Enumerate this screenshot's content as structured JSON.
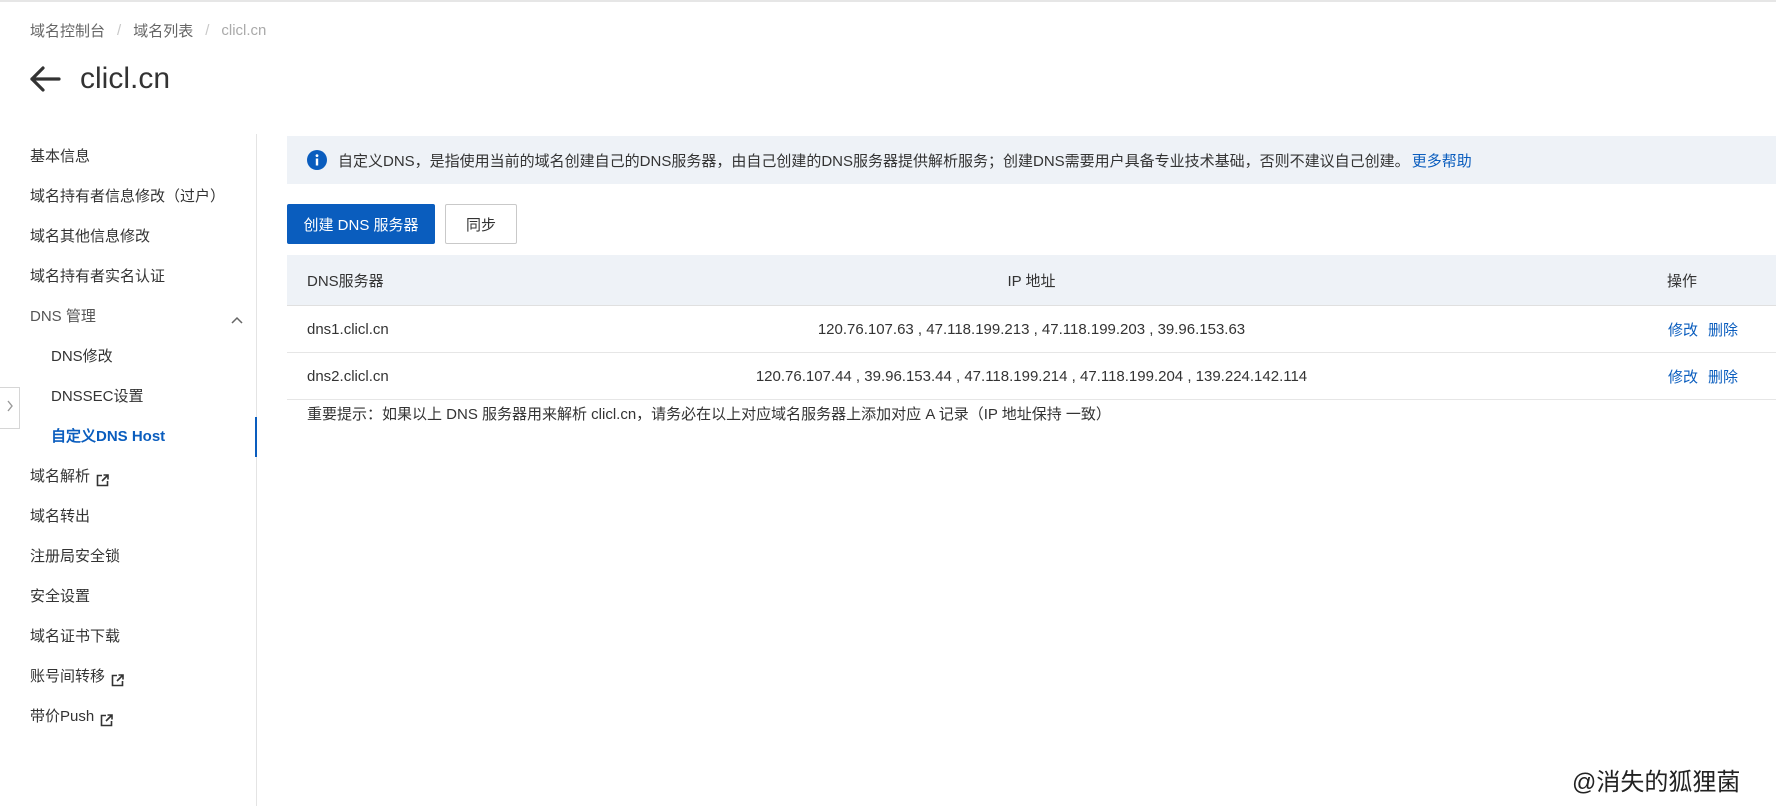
{
  "breadcrumb": [
    "域名控制台",
    "域名列表",
    "clicl.cn"
  ],
  "page": {
    "title": "clicl.cn"
  },
  "sidebar": {
    "items": [
      {
        "label": "基本信息"
      },
      {
        "label": "域名持有者信息修改（过户）"
      },
      {
        "label": "域名其他信息修改"
      },
      {
        "label": "域名持有者实名认证"
      },
      {
        "label": "DNS 管理",
        "expanded": true
      },
      {
        "label": "DNS修改"
      },
      {
        "label": "DNSSEC设置"
      },
      {
        "label": "自定义DNS Host",
        "active": true
      },
      {
        "label": "域名解析",
        "external": true
      },
      {
        "label": "域名转出"
      },
      {
        "label": "注册局安全锁"
      },
      {
        "label": "安全设置"
      },
      {
        "label": "域名证书下载"
      },
      {
        "label": "账号间转移",
        "external": true
      },
      {
        "label": "带价Push",
        "external": true
      }
    ]
  },
  "banner": {
    "text": "自定义DNS，是指使用当前的域名创建自己的DNS服务器，由自己创建的DNS服务器提供解析服务；创建DNS需要用户具备专业技术基础，否则不建议自己创建。",
    "link": "更多帮助"
  },
  "toolbar": {
    "create_label": "创建 DNS 服务器",
    "sync_label": "同步"
  },
  "table": {
    "headers": {
      "name": "DNS服务器",
      "ip": "IP 地址",
      "ops": "操作"
    },
    "rows": [
      {
        "name": "dns1.clicl.cn",
        "ips": "120.76.107.63 , 47.118.199.213 , 47.118.199.203 , 39.96.153.63",
        "edit": "修改",
        "delete": "删除"
      },
      {
        "name": "dns2.clicl.cn",
        "ips": "120.76.107.44 , 39.96.153.44 , 47.118.199.214 , 47.118.199.204 , 139.224.142.114",
        "edit": "修改",
        "delete": "删除"
      }
    ]
  },
  "notice": "重要提示：如果以上 DNS 服务器用来解析 clicl.cn，请务必在以上对应域名服务器上添加对应 A 记录（IP 地址保持 一致）",
  "watermark": "@消失的狐狸菌",
  "colors": {
    "primary": "#0a5dbe",
    "banner_bg": "#eef2f7",
    "info_icon": "#0a5dbe"
  }
}
